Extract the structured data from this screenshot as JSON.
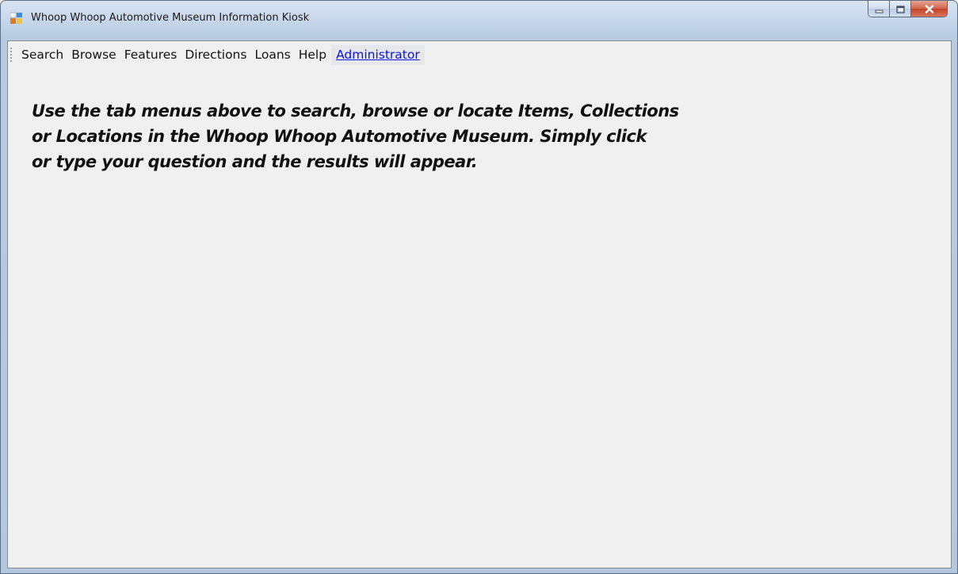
{
  "window": {
    "title": "Whoop Whoop Automotive Museum Information Kiosk",
    "icon": "application-icon",
    "controls": {
      "minimize": "minimize-icon",
      "maximize": "maximize-icon",
      "close": "close-icon"
    }
  },
  "menu": {
    "items": [
      {
        "label": "Search"
      },
      {
        "label": "Browse"
      },
      {
        "label": "Features"
      },
      {
        "label": "Directions"
      },
      {
        "label": "Loans"
      },
      {
        "label": "Help"
      },
      {
        "label": "Administrator"
      }
    ]
  },
  "main": {
    "intro_lines": [
      "Use the tab menus above to search, browse or locate Items, Collections",
      "or Locations in the Whoop Whoop Automotive Museum.  Simply click",
      "or type your question and the results will appear."
    ]
  },
  "colors": {
    "link": "#0a14e0",
    "client_background": "#f0f0f0",
    "close_button": "#c4432a"
  }
}
